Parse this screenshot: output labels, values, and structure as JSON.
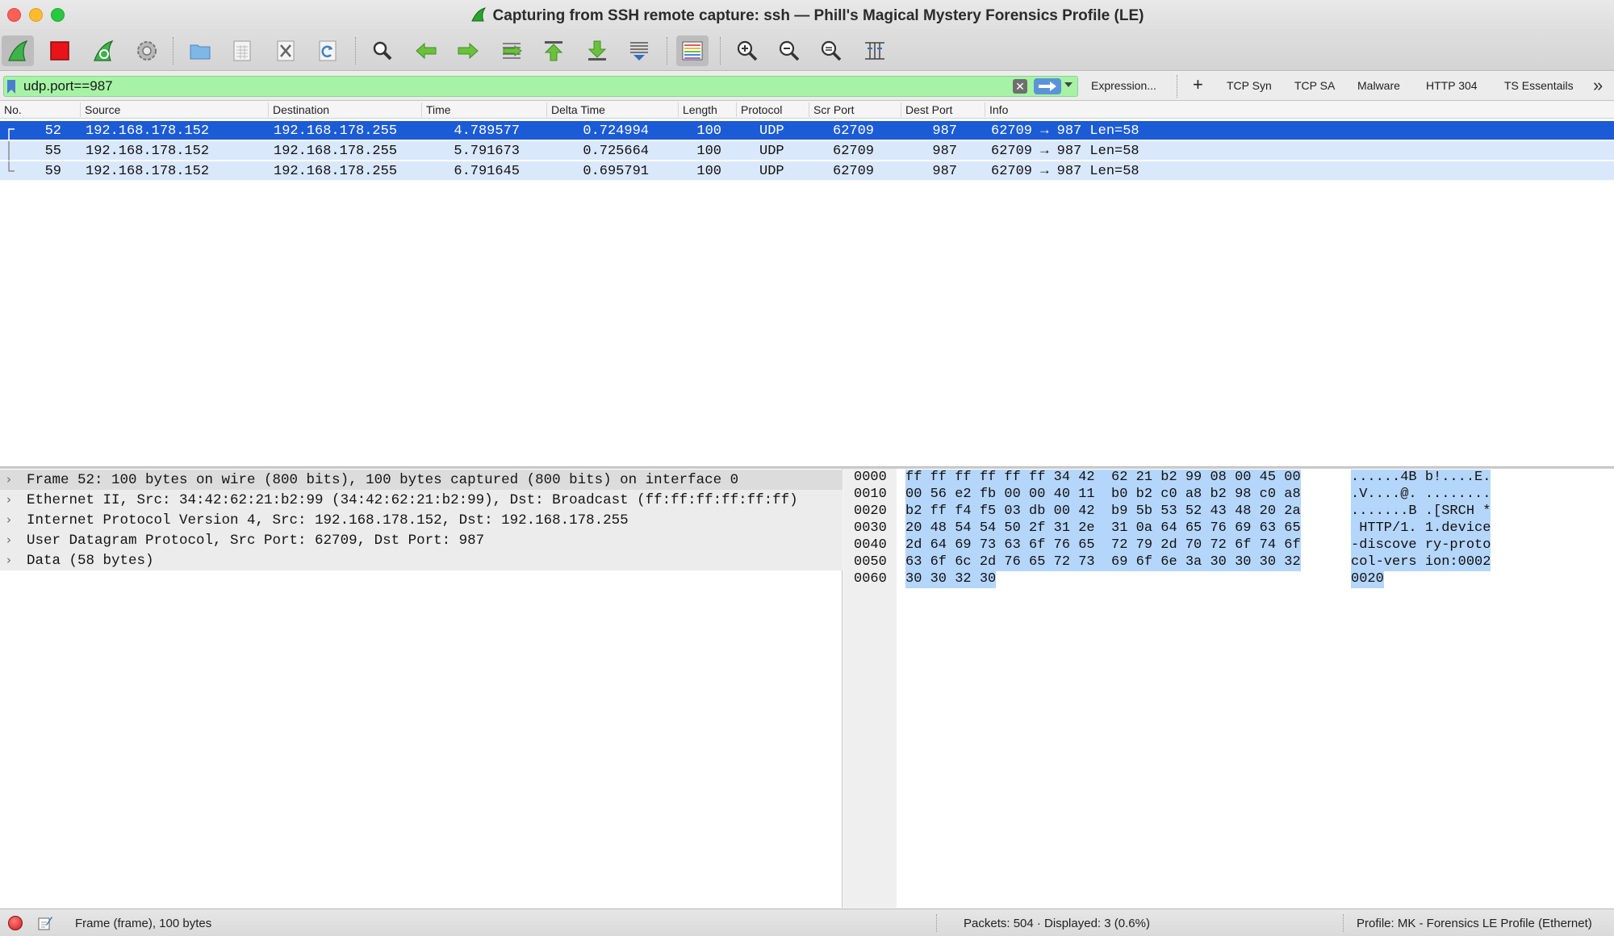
{
  "window": {
    "title": "Capturing from SSH remote capture: ssh — Phill's Magical Mystery Forensics Profile (LE)"
  },
  "toolbar": {
    "buttons": [
      "start-capture",
      "stop-capture",
      "restart-capture",
      "capture-options",
      "open-file",
      "save-file",
      "close-file",
      "reload-file",
      "find-packet",
      "go-back",
      "go-forward",
      "go-to-packet",
      "go-first",
      "go-last",
      "auto-scroll",
      "colorize",
      "zoom-in",
      "zoom-out",
      "normal-size",
      "resize-columns"
    ]
  },
  "filter": {
    "value": "udp.port==987",
    "expression_label": "Expression...",
    "add_label": "+",
    "buttons": [
      "TCP Syn",
      "TCP SA",
      "Malware",
      "HTTP 304",
      "TS Essentails"
    ],
    "more_label": "»"
  },
  "packet_list": {
    "columns": [
      "No.",
      "Source",
      "Destination",
      "Time",
      "Delta Time",
      "Length",
      "Protocol",
      "Scr Port",
      "Dest Port",
      "Info"
    ],
    "rows": [
      {
        "no": "52",
        "source": "192.168.178.152",
        "destination": "192.168.178.255",
        "time": "4.789577",
        "delta": "0.724994",
        "length": "100",
        "protocol": "UDP",
        "srcport": "62709",
        "dstport": "987",
        "info": "62709 → 987 Len=58"
      },
      {
        "no": "55",
        "source": "192.168.178.152",
        "destination": "192.168.178.255",
        "time": "5.791673",
        "delta": "0.725664",
        "length": "100",
        "protocol": "UDP",
        "srcport": "62709",
        "dstport": "987",
        "info": "62709 → 987 Len=58"
      },
      {
        "no": "59",
        "source": "192.168.178.152",
        "destination": "192.168.178.255",
        "time": "6.791645",
        "delta": "0.695791",
        "length": "100",
        "protocol": "UDP",
        "srcport": "62709",
        "dstport": "987",
        "info": "62709 → 987 Len=58"
      }
    ]
  },
  "details": {
    "items": [
      "Frame 52: 100 bytes on wire (800 bits), 100 bytes captured (800 bits) on interface 0",
      "Ethernet II, Src: 34:42:62:21:b2:99 (34:42:62:21:b2:99), Dst: Broadcast (ff:ff:ff:ff:ff:ff)",
      "Internet Protocol Version 4, Src: 192.168.178.152, Dst: 192.168.178.255",
      "User Datagram Protocol, Src Port: 62709, Dst Port: 987",
      "Data (58 bytes)"
    ]
  },
  "bytes": {
    "lines": [
      {
        "offset": "0000",
        "hex": "ff ff ff ff ff ff 34 42  62 21 b2 99 08 00 45 00",
        "ascii": "......4B b!....E."
      },
      {
        "offset": "0010",
        "hex": "00 56 e2 fb 00 00 40 11  b0 b2 c0 a8 b2 98 c0 a8",
        "ascii": ".V....@. ........"
      },
      {
        "offset": "0020",
        "hex": "b2 ff f4 f5 03 db 00 42  b9 5b 53 52 43 48 20 2a",
        "ascii": ".......B .[SRCH *"
      },
      {
        "offset": "0030",
        "hex": "20 48 54 54 50 2f 31 2e  31 0a 64 65 76 69 63 65",
        "ascii": " HTTP/1. 1.device"
      },
      {
        "offset": "0040",
        "hex": "2d 64 69 73 63 6f 76 65  72 79 2d 70 72 6f 74 6f",
        "ascii": "-discove ry-proto"
      },
      {
        "offset": "0050",
        "hex": "63 6f 6c 2d 76 65 72 73  69 6f 6e 3a 30 30 30 32",
        "ascii": "col-vers ion:0002"
      },
      {
        "offset": "0060",
        "hex": "30 30 32 30",
        "ascii": "0020"
      }
    ]
  },
  "status": {
    "frame_info": "Frame (frame), 100 bytes",
    "packets": "Packets: 504 · Displayed: 3 (0.6%)",
    "profile": "Profile: MK - Forensics LE Profile (Ethernet)"
  },
  "colors": {
    "filter_ok": "#a6f3a6",
    "selected_row": "#1c5bd6",
    "related_row": "#dae8fc",
    "byte_highlight": "#b5d6fb"
  }
}
